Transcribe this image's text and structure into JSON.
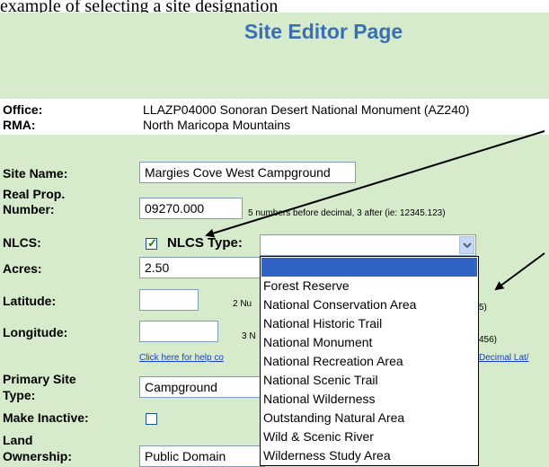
{
  "caption_text": "example of selecting a site designation",
  "page_title": "Site Editor Page",
  "office": {
    "label": "Office:",
    "value": "LLAZP04000 Sonoran Desert National Monument (AZ240)"
  },
  "rma": {
    "label": "RMA:",
    "value": "North Maricopa Mountains"
  },
  "site_name": {
    "label": "Site Name:",
    "value": "Margies Cove West Campground"
  },
  "real_prop": {
    "label_line1": "Real Prop.",
    "label_line2": "Number:",
    "value": "09270.000",
    "hint": "5 numbers before decimal, 3 after (ie: 12345.123)"
  },
  "nlcs": {
    "label": "NLCS:",
    "checked": true,
    "check_glyph": "✓",
    "type_label": "NLCS Type:",
    "selected_value": "",
    "options": [
      "",
      "Forest Reserve",
      "National Conservation Area",
      "National Historic Trail",
      "National Monument",
      "National Recreation Area",
      "National Scenic Trail",
      "National Wilderness",
      "Outstanding Natural Area",
      "Wild & Scenic River",
      "Wilderness Study Area"
    ]
  },
  "acres": {
    "label": "Acres:",
    "value": "2.50"
  },
  "latitude": {
    "label": "Latitude:",
    "value": "",
    "hint_left": "2 Nu",
    "hint_right": "5)"
  },
  "longitude": {
    "label": "Longitude:",
    "value": "",
    "hint_left": "3 N",
    "hint_right": "456)"
  },
  "help_link": {
    "left": "Click here for help co",
    "right": "Decimal Lat/"
  },
  "primary_site_type": {
    "label_line1": "Primary Site",
    "label_line2": "Type:",
    "value": "Campground"
  },
  "make_inactive": {
    "label": "Make Inactive:",
    "checked": false
  },
  "land_ownership": {
    "label_line1": "Land",
    "label_line2": "Ownership:",
    "value": "Public Domain"
  },
  "colors": {
    "panel_bg": "#d6ebcb",
    "title": "#3a6fb6",
    "link": "#1a3fc8",
    "highlight": "#3163c5"
  },
  "icons": {
    "dropdown_arrow": "chevron-down-icon",
    "annotation_arrows": "arrow-icon"
  }
}
